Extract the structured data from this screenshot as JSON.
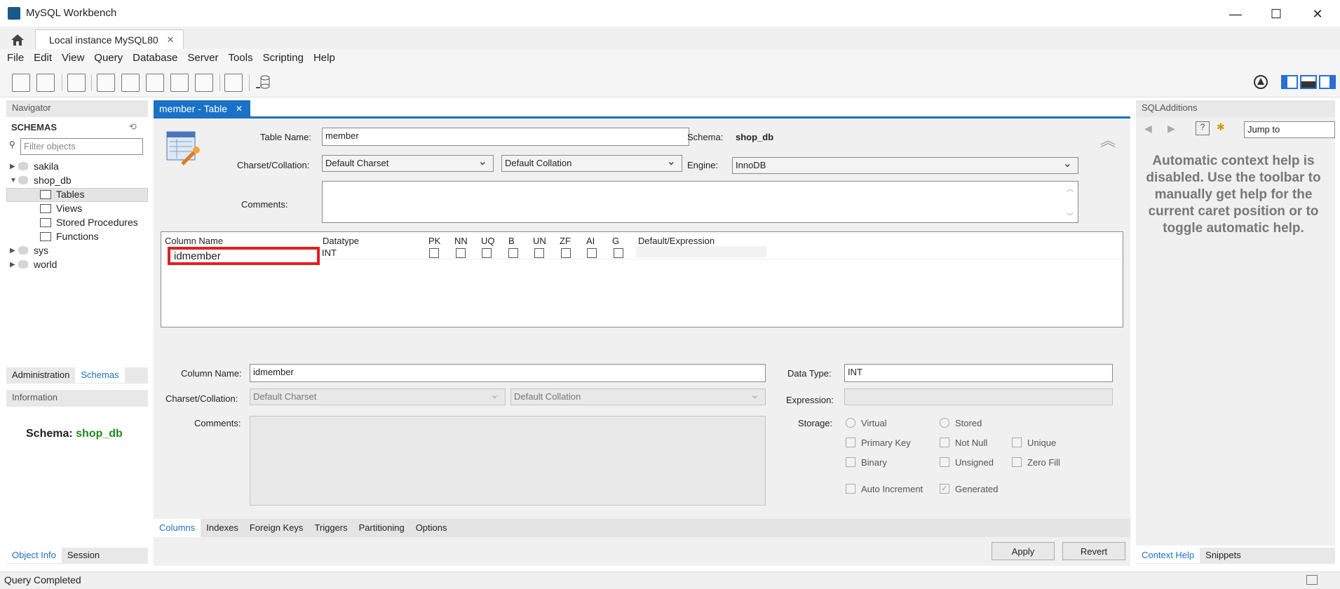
{
  "window": {
    "title": "MySQL Workbench"
  },
  "tabs": {
    "connection": "Local instance MySQL80"
  },
  "menu": [
    "File",
    "Edit",
    "View",
    "Query",
    "Database",
    "Server",
    "Tools",
    "Scripting",
    "Help"
  ],
  "navigator": {
    "header": "Navigator",
    "schemas_label": "SCHEMAS",
    "filter_placeholder": "Filter objects",
    "tree": [
      "sakila",
      "shop_db",
      "Tables",
      "Views",
      "Stored Procedures",
      "Functions",
      "sys",
      "world"
    ],
    "tabs": [
      "Administration",
      "Schemas"
    ],
    "info_header": "Information",
    "schema_label": "Schema:",
    "schema_name": "shop_db",
    "bottom_tabs": [
      "Object Info",
      "Session"
    ]
  },
  "editor": {
    "tab_title": "member - Table",
    "table_name_label": "Table Name:",
    "table_name": "member",
    "schema_label": "Schema:",
    "schema_value": "shop_db",
    "charset_label": "Charset/Collation:",
    "charset": "Default Charset",
    "collation": "Default Collation",
    "engine_label": "Engine:",
    "engine": "InnoDB",
    "comments_label": "Comments:",
    "grid_headers": [
      "Column Name",
      "Datatype",
      "PK",
      "NN",
      "UQ",
      "B",
      "UN",
      "ZF",
      "AI",
      "G",
      "Default/Expression"
    ],
    "rows": [
      {
        "name": "idmember",
        "type": "INT"
      }
    ],
    "detail": {
      "column_name_label": "Column Name:",
      "column_name": "idmember",
      "datatype_label": "Data Type:",
      "datatype": "INT",
      "charset_label": "Charset/Collation:",
      "charset": "Default Charset",
      "collation": "Default Collation",
      "expression_label": "Expression:",
      "comments_label": "Comments:",
      "storage_label": "Storage:",
      "virtual": "Virtual",
      "stored": "Stored",
      "primary_key": "Primary Key",
      "not_null": "Not Null",
      "unique": "Unique",
      "binary": "Binary",
      "unsigned": "Unsigned",
      "zero_fill": "Zero Fill",
      "auto_increment": "Auto Increment",
      "generated": "Generated"
    },
    "bottom_tabs": [
      "Columns",
      "Indexes",
      "Foreign Keys",
      "Triggers",
      "Partitioning",
      "Options"
    ],
    "apply": "Apply",
    "revert": "Revert"
  },
  "sqladditions": {
    "header": "SQLAdditions",
    "jump_to": "Jump to",
    "help_text": "Automatic context help is disabled. Use the toolbar to manually get help for the current caret position or to toggle automatic help.",
    "bottom_tabs": [
      "Context Help",
      "Snippets"
    ]
  },
  "status": "Query Completed",
  "colors": {
    "accent": "#1a72c6",
    "schema_green": "#1e8c1e",
    "highlight": "#e02020"
  }
}
